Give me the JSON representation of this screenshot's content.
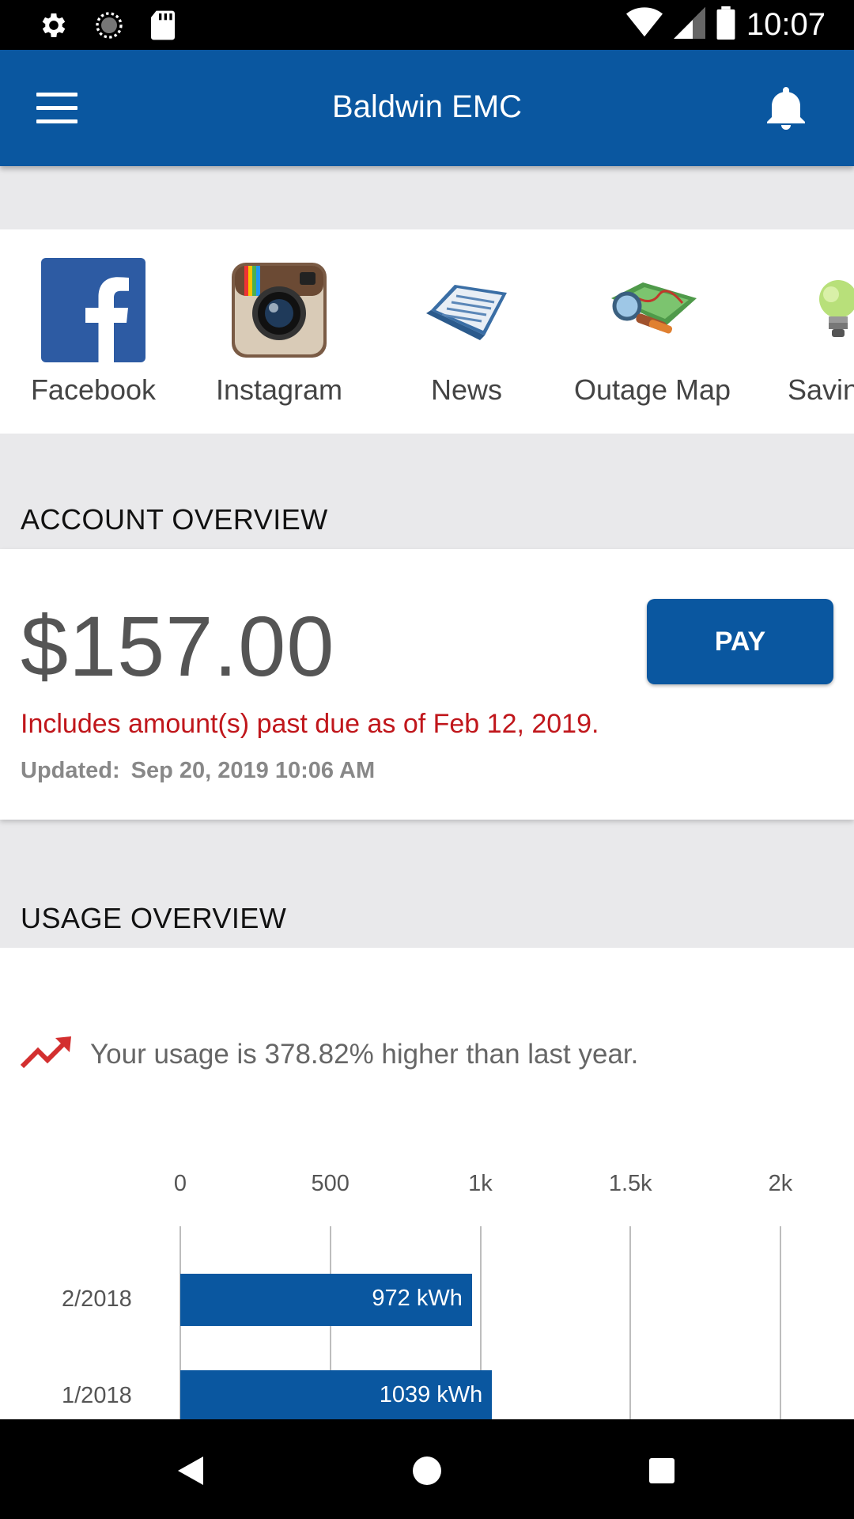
{
  "status_bar": {
    "time": "10:07"
  },
  "app_bar": {
    "title": "Baldwin EMC"
  },
  "quick_links": [
    {
      "label": "Facebook",
      "icon": "facebook-icon"
    },
    {
      "label": "Instagram",
      "icon": "instagram-icon"
    },
    {
      "label": "News",
      "icon": "newspaper-icon"
    },
    {
      "label": "Outage Map",
      "icon": "map-icon"
    },
    {
      "label": "Savings",
      "icon": "lightbulb-icon"
    }
  ],
  "account": {
    "section_title": "ACCOUNT OVERVIEW",
    "amount": "$157.00",
    "pay_label": "PAY",
    "past_due_text": "Includes amount(s) past due as of Feb 12, 2019.",
    "updated_label": "Updated:",
    "updated_value": "Sep 20, 2019 10:06 AM"
  },
  "usage": {
    "section_title": "USAGE OVERVIEW",
    "trend_text": "Your usage is 378.82% higher than last year."
  },
  "colors": {
    "brand": "#0a57a0",
    "alert": "#c0161b",
    "trend": "#d32f2f"
  },
  "chart_data": {
    "type": "bar",
    "orientation": "horizontal",
    "categories": [
      "2/2018",
      "1/2018"
    ],
    "values": [
      972,
      1039
    ],
    "value_labels": [
      "972 kWh",
      "1039 kWh"
    ],
    "unit": "kWh",
    "xlim": [
      0,
      2000
    ],
    "ticks": [
      0,
      500,
      1000,
      1500,
      2000
    ],
    "tick_labels": [
      "0",
      "500",
      "1k",
      "1.5k",
      "2k"
    ],
    "grid": true
  }
}
